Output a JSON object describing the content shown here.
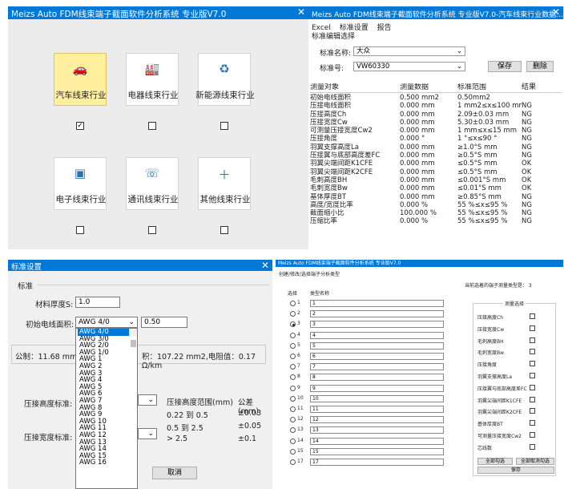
{
  "win1": {
    "title": "Meizs Auto FDM线束端子截面软件分析系统 专业版V7.0",
    "close": "✕",
    "tiles": [
      {
        "label": "汽车线束行业",
        "icon": "car-icon",
        "selected": true,
        "checked": true
      },
      {
        "label": "电器线束行业",
        "icon": "factory-icon",
        "selected": false,
        "checked": false
      },
      {
        "label": "新能源线束行业",
        "icon": "eco-leaf-icon",
        "selected": false,
        "checked": false
      },
      {
        "label": "电子线束行业",
        "icon": "chip-icon",
        "selected": false,
        "checked": false
      },
      {
        "label": "通讯线束行业",
        "icon": "phone-icon",
        "selected": false,
        "checked": false
      },
      {
        "label": "其他线束行业",
        "icon": "plus-icon",
        "selected": false,
        "checked": false
      }
    ]
  },
  "win2": {
    "title": "Meizs Auto FDM线束端子截面软件分析系统 专业版V7.0-汽车线束行业数据...",
    "close": "✕",
    "menu": [
      "Excel",
      "标准设置",
      "报告"
    ],
    "group_label": "标准编辑选择",
    "std_name_label": "标准名称:",
    "std_name_value": "大众",
    "std_no_label": "标准号:",
    "std_no_value": "VW60330",
    "save_label": "保存",
    "delete_label": "删除",
    "headers": [
      "测量对象",
      "测量数据",
      "标准范围",
      "结果"
    ],
    "rows": [
      [
        "初始电线面积",
        "0.500 mm2",
        "0.50mm2",
        ""
      ],
      [
        "压接电线面积",
        "0.000 mm",
        "1 mm2≤x≤100 mm2",
        "NG"
      ],
      [
        "压接高度Ch",
        "0.000 mm",
        "2.09±0.03 mm",
        "NG"
      ],
      [
        "压接宽度Cw",
        "0.000 mm",
        "5.30±0.03 mm",
        "NG"
      ],
      [
        "可测量压接宽度Cw2",
        "0.000 mm",
        "1 mm≤x≤15 mm",
        "NG"
      ],
      [
        "压接角度",
        "0.000 °",
        "1 °≤x≤90 °",
        "NG"
      ],
      [
        "羽翼支撑高度La",
        "0.000 mm",
        "≥1.0°S mm",
        "NG"
      ],
      [
        "压接翼与底部高度差FC",
        "0.000 mm",
        "≥0.5°S mm",
        "NG"
      ],
      [
        "羽翼尖端间距K1CFE",
        "0.000 mm",
        "≤0.5°S mm",
        "OK"
      ],
      [
        "羽翼尖端间距K2CFE",
        "0.000 mm",
        "≤0.5°S mm",
        "OK"
      ],
      [
        "毛刺高度BH",
        "0.000 mm",
        "≤0.001°S mm",
        "OK"
      ],
      [
        "毛刺宽度Bw",
        "0.000 mm",
        "≤0.01°S mm",
        "OK"
      ],
      [
        "基体厚度BT",
        "0.000 mm",
        "≥0.85°S mm",
        "NG"
      ],
      [
        "高度/宽度比率",
        "0.000 %",
        "55 %≤x≤95 %",
        "NG"
      ],
      [
        "截面缩小比",
        "100.000 %",
        "55 %≤x≤95 %",
        "NG"
      ],
      [
        "压缩比率",
        "0.000 %",
        "55 %≤x≤95 %",
        "NG"
      ]
    ]
  },
  "win3": {
    "title": "标准设置",
    "close": "✕",
    "section_label": "标准",
    "thickness_label": "材料厚度S:",
    "thickness_value": "1.0",
    "wire_area_label": "初始电线面积:",
    "wire_selected": "AWG 4/0",
    "wire_value": "0.50",
    "info_left": "公制：11.68 mm,外",
    "info_right": "积：107.22  mm2,电阻值：0.17 Ω/km",
    "crimp_h_label": "压接高度标准:",
    "crimp_w_label": "压接宽度标准:",
    "range_header": "压接高度范围(mm)",
    "tol_header": "公差(mm)",
    "ranges": [
      {
        "range": "0.22 到 0.5",
        "tol": "±0.03"
      },
      {
        "range": "0.5 到 2.5",
        "tol": "±0.05"
      },
      {
        "range": "> 2.5",
        "tol": "±0.1"
      }
    ],
    "cancel_label": "取消",
    "options": [
      "AWG 4/0",
      "AWG 3/0",
      "AWG 2/0",
      "AWG 1/0",
      "AWG 1",
      "AWG 2",
      "AWG 3",
      "AWG 4",
      "AWG 5",
      "AWG 6",
      "AWG 7",
      "AWG 8",
      "AWG 9",
      "AWG 10",
      "AWG 11",
      "AWG 12",
      "AWG 13",
      "AWG 14",
      "AWG 15",
      "AWG 16"
    ]
  },
  "win4": {
    "title": "Meizs Auto FDM线束端子截面软件分析系统 专业版V7.0",
    "subtitle": "创建/修改/选择端子分析类型",
    "current_label": "当前选着的端子测量类型是：  3",
    "col_select": "选择",
    "col_name": "类型名称",
    "types": [
      "1",
      "2",
      "3",
      "4",
      "5",
      "6",
      "7",
      "8",
      "9",
      "10",
      "11",
      "12",
      "13",
      "14",
      "15",
      "17"
    ],
    "selected_index": 2,
    "measure_group": "测量选择",
    "measures": [
      "压接高度Ch",
      "压接宽度Cw",
      "毛刺高度BH",
      "毛刺宽度Bw",
      "压接角度",
      "羽翼支撑高度La",
      "压接翼与底部高度差FC",
      "羽翼尖端间距K1CFE",
      "羽翼尖端间距K2CFE",
      "基体厚度BT",
      "可测量压接宽度Cw2",
      "芯线数"
    ],
    "select_all": "全部勾选",
    "deselect_all": "全部取消勾选",
    "save": "保存"
  }
}
